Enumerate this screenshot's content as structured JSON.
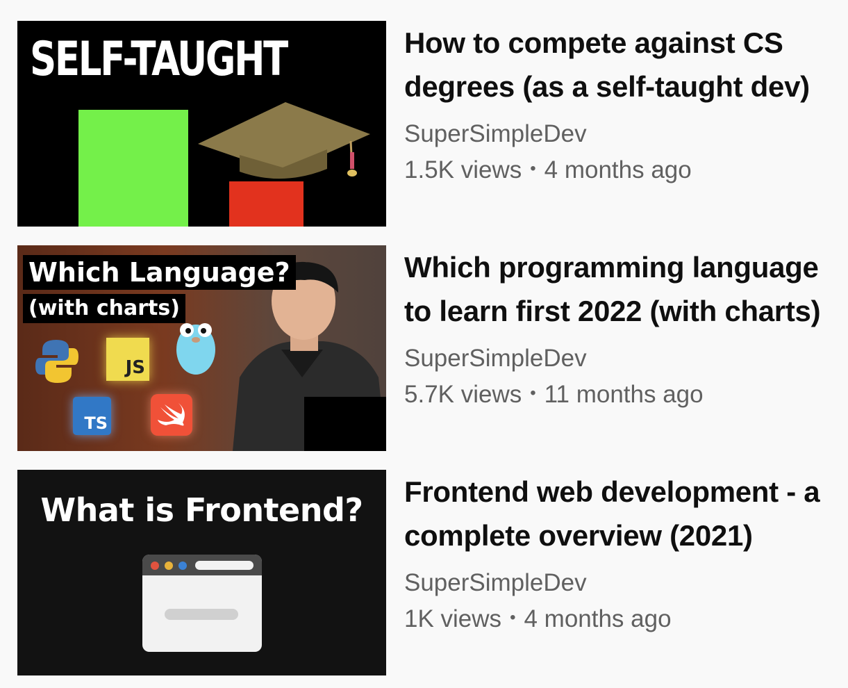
{
  "videos": [
    {
      "title_lines": [
        "How to compete against CS",
        "degrees (as a self-taught dev)"
      ],
      "channel": "SuperSimpleDev",
      "views": "1.5K views",
      "age": "4 months ago",
      "thumbnail": {
        "text": "SELF-TAUGHT",
        "colors": {
          "background": "#000000",
          "green_bar": "#74f04a",
          "red_bar": "#e2321e",
          "cap": "#8b7a4a",
          "tassel": "#d0506a"
        },
        "icons": [
          "graduation-cap-icon"
        ]
      }
    },
    {
      "title_lines": [
        "Which programming language",
        "to learn first 2022 (with charts)"
      ],
      "channel": "SuperSimpleDev",
      "views": "5.7K views",
      "age": "11 months ago",
      "thumbnail": {
        "label_main": "Which Language?",
        "label_sub": "(with charts)",
        "js_logo": "JS",
        "ts_logo": "TS",
        "icons": [
          "python-logo-icon",
          "javascript-logo-icon",
          "go-gopher-icon",
          "typescript-logo-icon",
          "swift-logo-icon",
          "presenter-photo"
        ]
      }
    },
    {
      "title_lines": [
        "Frontend web development - a",
        "complete overview (2021)"
      ],
      "channel": "SuperSimpleDev",
      "views": "1K views",
      "age": "4 months ago",
      "thumbnail": {
        "text": "What is Frontend?",
        "icons": [
          "browser-window-icon"
        ],
        "colors": {
          "dot_red": "#e2533f",
          "dot_yellow": "#e8b23a",
          "dot_blue": "#3b82d6"
        }
      }
    }
  ],
  "separator": "•"
}
